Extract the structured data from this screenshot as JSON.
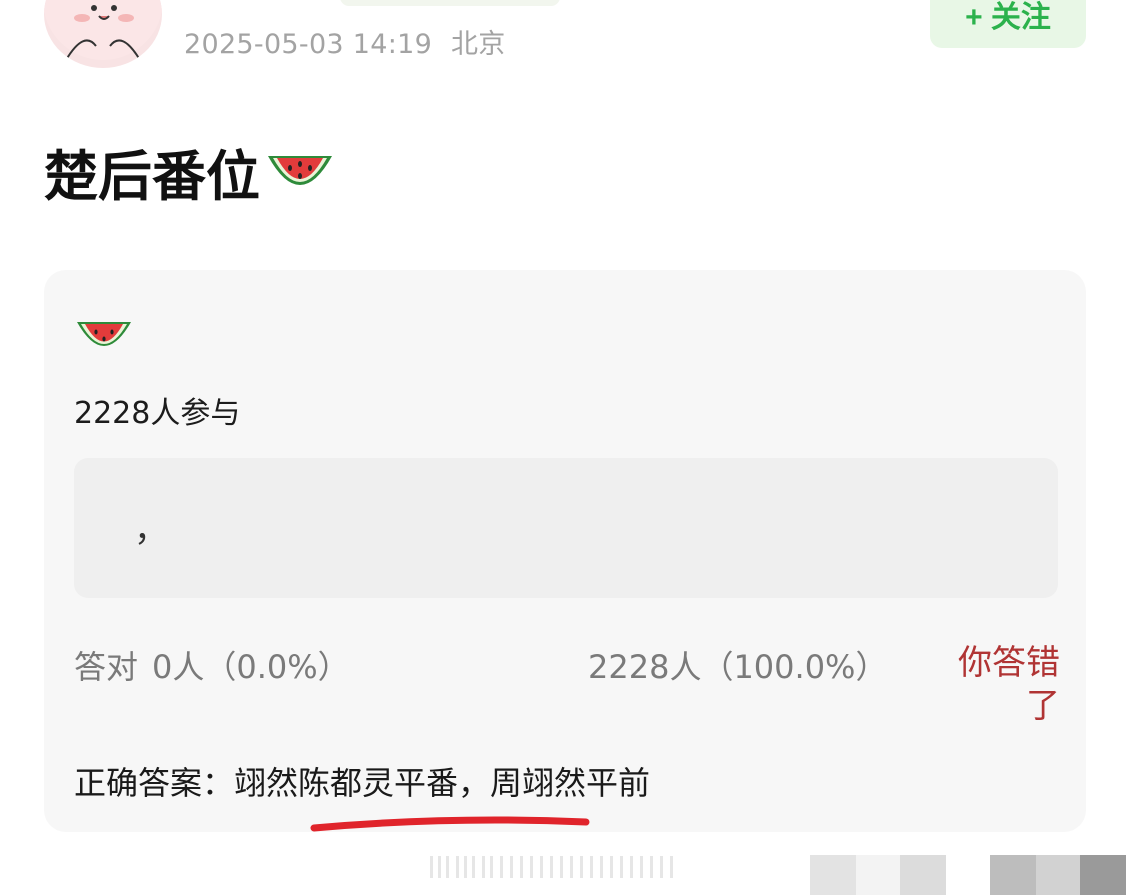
{
  "post": {
    "date": "2025-05-03 14:19",
    "location": "北京",
    "follow_label": "+ 关注",
    "title": "楚后番位",
    "title_icon": "watermelon-icon"
  },
  "poll": {
    "icon": "watermelon-icon",
    "participants": "2228人参与",
    "option_text": "，",
    "correct_label": "答对",
    "correct_count": "0人（0.0%）",
    "wrong_count": "2228人（100.0%）",
    "result": "你答错了",
    "answer_label": "正确答案：",
    "answer_text": "翊然陈都灵平番，周翊然平前"
  },
  "colors": {
    "follow_green": "#2bb24c",
    "wrong_red": "#b03434",
    "underline_red": "#e0242b"
  }
}
